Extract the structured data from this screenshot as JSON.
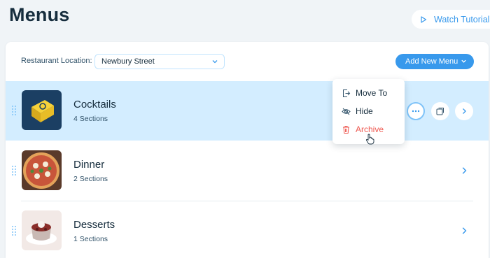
{
  "page": {
    "title": "Menus"
  },
  "header": {
    "tutorial_label": "Watch Tutorial"
  },
  "toolbar": {
    "location_label": "Restaurant Location:",
    "location_value": "Newbury Street",
    "add_menu_label": "Add New Menu"
  },
  "menus": [
    {
      "name": "Cocktails",
      "sections": "4 Sections"
    },
    {
      "name": "Dinner",
      "sections": "2 Sections"
    },
    {
      "name": "Desserts",
      "sections": "1 Sections"
    }
  ],
  "context_menu": {
    "move_to": "Move To",
    "hide": "Hide",
    "archive": "Archive"
  },
  "colors": {
    "accent": "#3899ec",
    "selected_row": "#d3edff",
    "danger": "#ee5951",
    "text": "#162d3d"
  }
}
